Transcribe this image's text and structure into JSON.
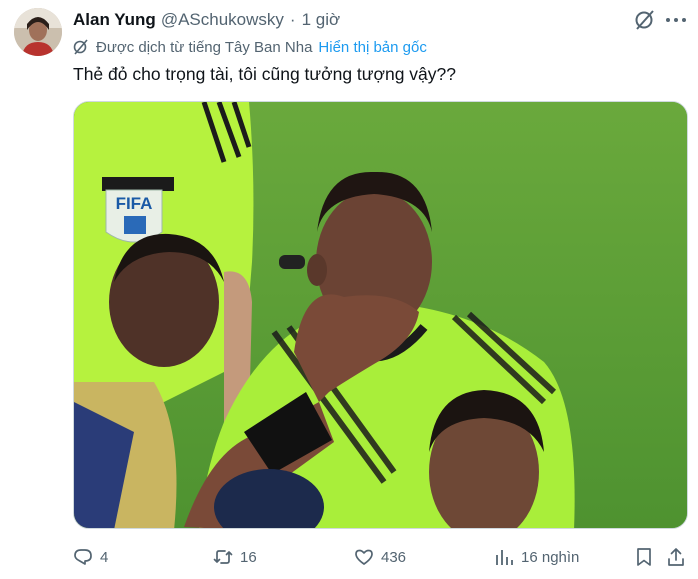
{
  "author": {
    "name": "Alan Yung",
    "handle": "@ASchukowsky",
    "separator": "·",
    "time": "1 giờ"
  },
  "translation": {
    "note": "Được dịch từ tiếng Tây Ban Nha",
    "show_original": "Hiển thị bản gốc"
  },
  "tweet": {
    "text": "Thẻ đỏ cho trọng tài, tôi cũng tưởng tượng vậy??"
  },
  "media": {
    "badge_text": "FIFA"
  },
  "actions": {
    "replies": "4",
    "reposts": "16",
    "likes": "436",
    "views": "16 nghìn"
  },
  "icons": {
    "grok": "grok-icon",
    "more": "more-icon",
    "translate": "translate-icon",
    "reply": "reply-icon",
    "repost": "repost-icon",
    "like": "like-icon",
    "views": "views-icon",
    "bookmark": "bookmark-icon",
    "share": "share-icon"
  },
  "colors": {
    "link": "#1d9bf0",
    "secondary": "#536471",
    "text": "#0f1419"
  }
}
